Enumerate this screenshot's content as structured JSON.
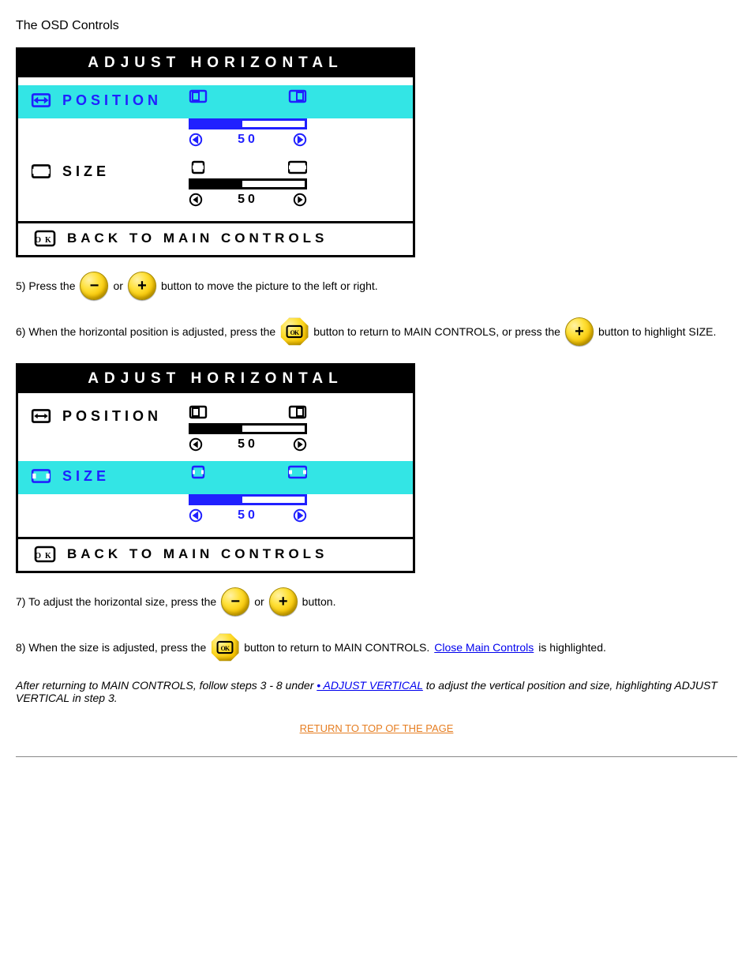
{
  "page": {
    "title": "The OSD Controls"
  },
  "osd": {
    "header": "ADJUST HORIZONTAL",
    "position": {
      "label": "POSITION",
      "value": 50,
      "fill_pct": 45
    },
    "size": {
      "label": "SIZE",
      "value": 50,
      "fill_pct": 45
    },
    "footer": "BACK TO MAIN CONTROLS"
  },
  "step5": {
    "prefix": "5) Press the ",
    "mid": " or ",
    "suffix": " button to move the picture to the left or right."
  },
  "step6": {
    "prefix": "6) When the horizontal position is adjusted, press the ",
    "after_ok": " button to return to MAIN CONTROLS, or press the ",
    "suffix": " button to highlight SIZE."
  },
  "step7": {
    "prefix": "7) To adjust the horizontal size, press the ",
    "mid": " or ",
    "suffix": " button."
  },
  "step8": {
    "prefix": "8) When the size is adjusted, press the ",
    "after_ok": " button to return to MAIN CONTROLS. ",
    "link": "Close Main Controls",
    "suffix": " is highlighted."
  },
  "note": {
    "prefix": "After returning to MAIN CONTROLS, follow steps 3 - 8 under ",
    "link": "• ADJUST VERTICAL",
    "suffix": " to adjust the vertical position and size, highlighting ADJUST VERTICAL in step 3."
  },
  "footer_link": "RETURN TO TOP OF THE PAGE"
}
